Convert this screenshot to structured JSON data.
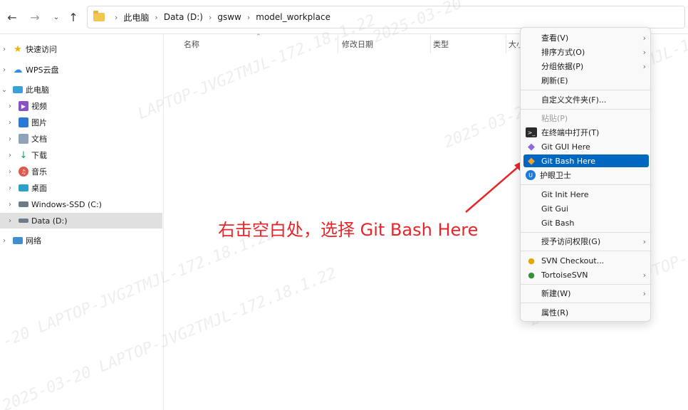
{
  "address_bar": {
    "breadcrumbs": [
      "此电脑",
      "Data (D:)",
      "gsww",
      "model_workplace"
    ]
  },
  "sidebar": {
    "items": [
      {
        "label": "快速访问",
        "icon": "star-icon"
      },
      {
        "label": "WPS云盘",
        "icon": "cloud-icon"
      },
      {
        "label": "此电脑",
        "icon": "computer-icon"
      },
      {
        "label": "视频",
        "icon": "video-icon"
      },
      {
        "label": "图片",
        "icon": "picture-icon"
      },
      {
        "label": "文档",
        "icon": "document-icon"
      },
      {
        "label": "下载",
        "icon": "download-icon"
      },
      {
        "label": "音乐",
        "icon": "music-icon"
      },
      {
        "label": "桌面",
        "icon": "desktop-icon"
      },
      {
        "label": "Windows-SSD (C:)",
        "icon": "drive-icon"
      },
      {
        "label": "Data (D:)",
        "icon": "drive-icon"
      },
      {
        "label": "网络",
        "icon": "network-icon"
      }
    ]
  },
  "columns": [
    "名称",
    "修改日期",
    "类型",
    "大小"
  ],
  "context_menu": {
    "items": [
      {
        "label": "查看(V)"
      },
      {
        "label": "排序方式(O)"
      },
      {
        "label": "分组依据(P)"
      },
      {
        "label": "刷新(E)"
      },
      {
        "label": "自定义文件夹(F)..."
      },
      {
        "label": "粘贴(P)"
      },
      {
        "label": "在终端中打开(T)"
      },
      {
        "label": "Git GUI Here"
      },
      {
        "label": "Git Bash Here"
      },
      {
        "label": "护眼卫士"
      },
      {
        "label": "Git Init Here"
      },
      {
        "label": "Git Gui"
      },
      {
        "label": "Git Bash"
      },
      {
        "label": "授予访问权限(G)"
      },
      {
        "label": "SVN Checkout..."
      },
      {
        "label": "TortoiseSVN"
      },
      {
        "label": "新建(W)"
      },
      {
        "label": "属性(R)"
      }
    ]
  },
  "annotation": {
    "text": "右击空白处，选择 Git Bash Here",
    "color": "#e8262a"
  },
  "watermark": {
    "text": "2025-03-20 LAPTOP-JVG2TMJL-172.18.1.22"
  },
  "colors": {
    "accent": "#0067c0",
    "selection": "#e0e0e0"
  }
}
